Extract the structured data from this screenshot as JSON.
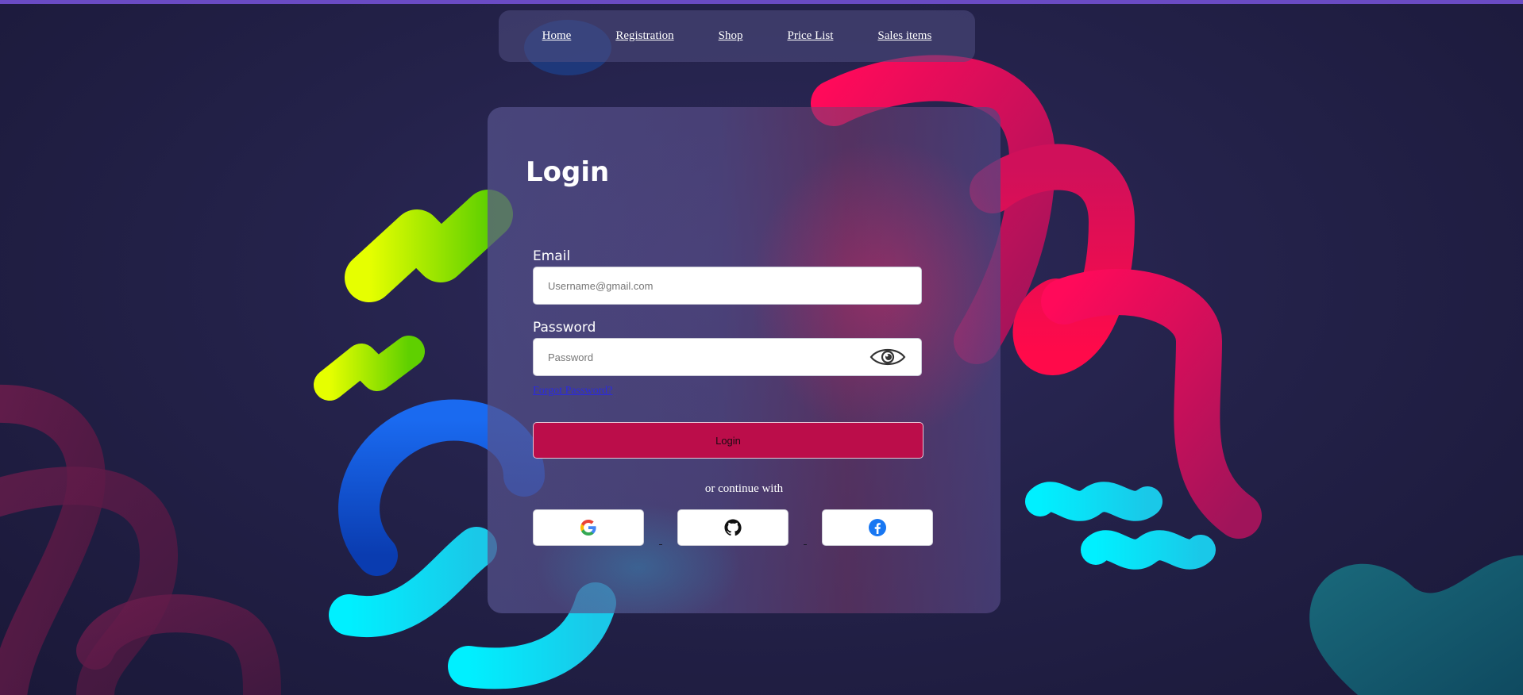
{
  "nav": {
    "items": [
      "Home",
      "Registration",
      "Shop",
      "Price List",
      "Sales items"
    ]
  },
  "login": {
    "title": "Login",
    "email_label": "Email",
    "email_placeholder": "Username@gmail.com",
    "password_label": "Password",
    "password_placeholder": "Password",
    "forgot_text": "Forgot Password?",
    "submit_label": "Login",
    "divider_text": "or continue with",
    "social": [
      {
        "name": "google",
        "icon": "google-icon"
      },
      {
        "name": "github",
        "icon": "github-icon"
      },
      {
        "name": "facebook",
        "icon": "facebook-icon"
      }
    ]
  },
  "colors": {
    "accent": "#bb0d4a",
    "top_bar": "#6a4bc4",
    "link": "#2a2ae0",
    "background": "#24224a"
  }
}
